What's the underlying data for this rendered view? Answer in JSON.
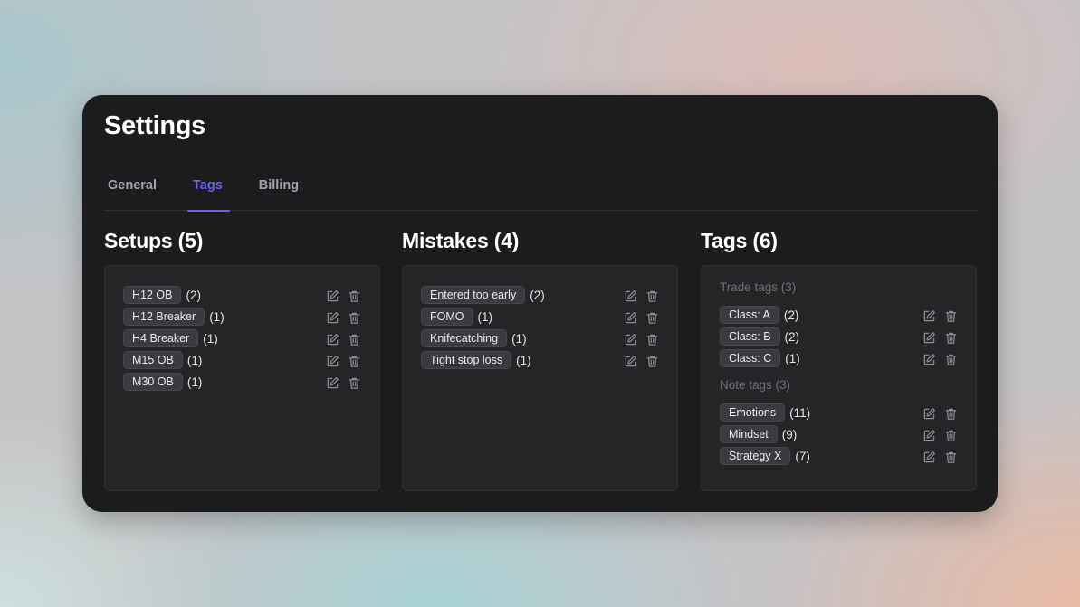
{
  "header": {
    "title": "Settings"
  },
  "tabs": [
    {
      "label": "General",
      "active": false
    },
    {
      "label": "Tags",
      "active": true
    },
    {
      "label": "Billing",
      "active": false
    }
  ],
  "accent_color": "#6b63e6",
  "setups": {
    "heading": "Setups (5)",
    "items": [
      {
        "label": "H12 OB",
        "count": "(2)"
      },
      {
        "label": "H12 Breaker",
        "count": "(1)"
      },
      {
        "label": "H4 Breaker",
        "count": "(1)"
      },
      {
        "label": "M15 OB",
        "count": "(1)"
      },
      {
        "label": "M30 OB",
        "count": "(1)"
      }
    ]
  },
  "mistakes": {
    "heading": "Mistakes (4)",
    "items": [
      {
        "label": "Entered too early",
        "count": "(2)"
      },
      {
        "label": "FOMO",
        "count": "(1)"
      },
      {
        "label": "Knifecatching",
        "count": "(1)"
      },
      {
        "label": "Tight stop loss",
        "count": "(1)"
      }
    ]
  },
  "tags": {
    "heading": "Tags (6)",
    "groups": [
      {
        "label": "Trade tags (3)",
        "items": [
          {
            "label": "Class: A",
            "count": "(2)"
          },
          {
            "label": "Class: B",
            "count": "(2)"
          },
          {
            "label": "Class: C",
            "count": "(1)"
          }
        ]
      },
      {
        "label": "Note tags (3)",
        "items": [
          {
            "label": "Emotions",
            "count": "(11)"
          },
          {
            "label": "Mindset",
            "count": "(9)"
          },
          {
            "label": "Strategy X",
            "count": "(7)"
          }
        ]
      }
    ]
  },
  "icons": {
    "edit": "edit-icon",
    "delete": "trash-icon"
  }
}
